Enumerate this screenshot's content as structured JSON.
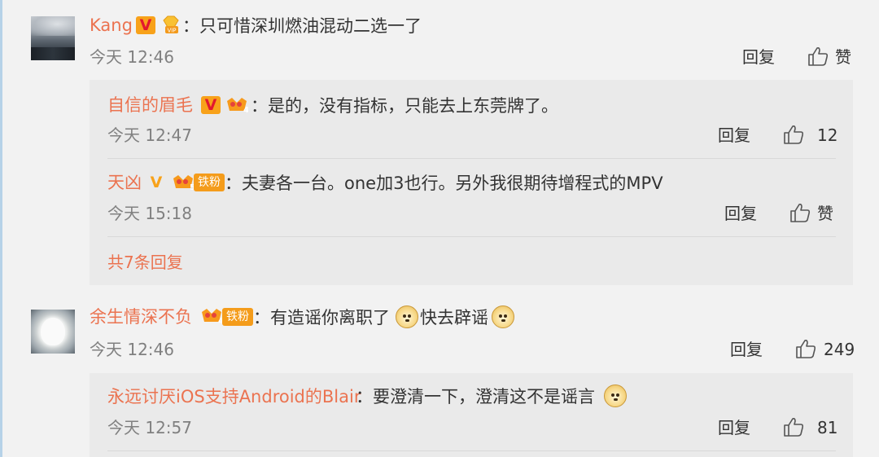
{
  "actions": {
    "reply": "回复",
    "like": "赞"
  },
  "comments": [
    {
      "user": "Kang",
      "text": "：只可惜深圳燃油混动二选一了",
      "time": "今天 12:46",
      "likes": "赞",
      "replies": [
        {
          "user": "自信的眉毛",
          "text": "：是的，没有指标，只能去上东莞牌了。",
          "time": "今天 12:47",
          "likes": "12"
        },
        {
          "user": "天凶",
          "text": "：夫妻各一台。one加3也行。另外我很期待增程式的MPV",
          "time": "今天 15:18",
          "likes": "赞"
        }
      ],
      "more_replies": "共7条回复"
    },
    {
      "user": "余生情深不负",
      "text_before": "：有造谣你离职了",
      "text_after": "快去辟谣",
      "time": "今天 12:46",
      "likes": "249",
      "replies": [
        {
          "user": "永远讨厌iOS支持Android的Blair",
          "text": "：要澄清一下，澄清这不是谣言",
          "time": "今天 12:57",
          "likes": "81"
        }
      ]
    }
  ],
  "badges": {
    "vip_label": "VIP",
    "fan_label": "铁粉",
    "crown_level_1": "4",
    "crown_level_2": "5",
    "crown_level_3": "4",
    "v_mark": "V"
  },
  "colors": {
    "username": "#eb7350",
    "text": "#333333",
    "time": "#808080",
    "background": "#f2f2f2",
    "reply_box": "#eaeaea",
    "badge_orange": "#f8a21a"
  }
}
